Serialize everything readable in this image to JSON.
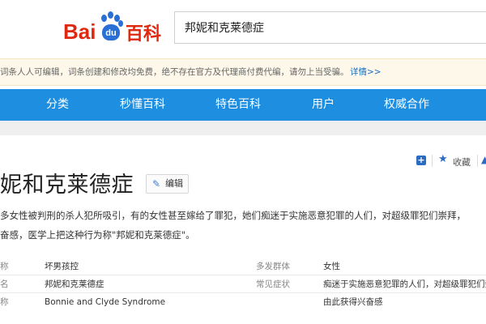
{
  "header": {
    "logo_bai": "Bai",
    "logo_du": "du",
    "logo_baike": "百科",
    "search_value": "邦妮和克莱德症"
  },
  "notice": {
    "text": "词条人人可编辑，词条创建和修改均免费，绝不存在官方及代理商付费代编，请勿上当受骗。",
    "link": "详情>>"
  },
  "nav": {
    "items": [
      "分类",
      "秒懂百科",
      "特色百科",
      "用户",
      "权威合作"
    ]
  },
  "tools": {
    "add_icon": "plus-square-icon",
    "collect_label": "收藏"
  },
  "entry": {
    "title": "妮和克莱德症",
    "edit_label": "编辑",
    "summary_line1": "多女性被判刑的杀人犯所吸引，有的女性甚至嫁给了罪犯，她们痴迷于实施恶意犯罪的人们，对超级罪犯们崇拜，",
    "summary_line2": "奋感，医学上把这种行为称\"邦妮和克莱德症\"。"
  },
  "info_table": {
    "rows": [
      {
        "k1": "称",
        "v1": "坏男孩控",
        "k2": "多发群体",
        "v2": "女性"
      },
      {
        "k1": "名",
        "v1": "邦妮和克莱德症",
        "k2": "常见症状",
        "v2": "痴迷于实施恶意犯罪的人们，对超级罪犯们崇"
      },
      {
        "k1": "称",
        "v1": "Bonnie and Clyde Syndrome",
        "k2": "",
        "v2": "由此获得兴奋感"
      }
    ]
  },
  "colors": {
    "nav_blue": "#1e8ee0",
    "brand_red": "#de2910",
    "logo_blue": "#2a6fd6",
    "link_blue": "#136ec2",
    "notice_bg": "#fdf8ea"
  }
}
